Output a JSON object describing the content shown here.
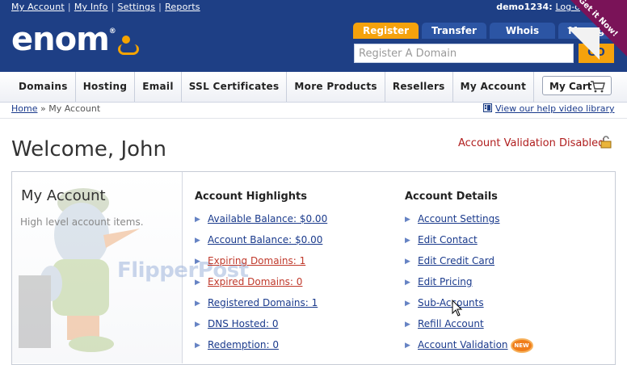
{
  "top_links": [
    "My Account",
    "My Info",
    "Settings",
    "Reports"
  ],
  "user": {
    "name": "demo1234:",
    "logout": "Log-o"
  },
  "logo": {
    "text": "enom",
    "reg": "®"
  },
  "corner_ribbon": "Get it Now!",
  "search": {
    "tabs": [
      "Register",
      "Transfer",
      "Whois",
      "Manag"
    ],
    "placeholder": "Register A Domain",
    "go_label": "GO"
  },
  "nav": [
    "Domains",
    "Hosting",
    "Email",
    "SSL Certificates",
    "More Products",
    "Resellers",
    "My Account"
  ],
  "cart_label": "My Cart",
  "breadcrumb": {
    "home": "Home",
    "sep": "»",
    "current": "My Account"
  },
  "help_link": "View our help video library",
  "welcome": "Welcome, John",
  "validation_status": "Account Validation Disabled",
  "left_panel": {
    "title": "My Account",
    "subtitle": "High level account items.",
    "watermark": "FlipperPost"
  },
  "highlights": {
    "title": "Account Highlights",
    "items": [
      {
        "label": "Available Balance: $0.00",
        "alert": false
      },
      {
        "label": "Account Balance: $0.00",
        "alert": false
      },
      {
        "label": "Expiring Domains: 1",
        "alert": true
      },
      {
        "label": "Expired Domains: 0",
        "alert": true
      },
      {
        "label": "Registered Domains: 1",
        "alert": false
      },
      {
        "label": "DNS Hosted: 0",
        "alert": false
      },
      {
        "label": "Redemption: 0",
        "alert": false
      }
    ]
  },
  "details": {
    "title": "Account Details",
    "items": [
      "Account Settings",
      "Edit Contact",
      "Edit Credit Card",
      "Edit Pricing",
      "Sub-Accounts",
      "Refill Account",
      "Account Validation"
    ],
    "new_badge": "NEW"
  },
  "colors": {
    "header_blue": "#1e3f85",
    "accent_orange": "#f5a20c",
    "alert_red": "#c0392b",
    "link_blue": "#1a3a8c"
  }
}
